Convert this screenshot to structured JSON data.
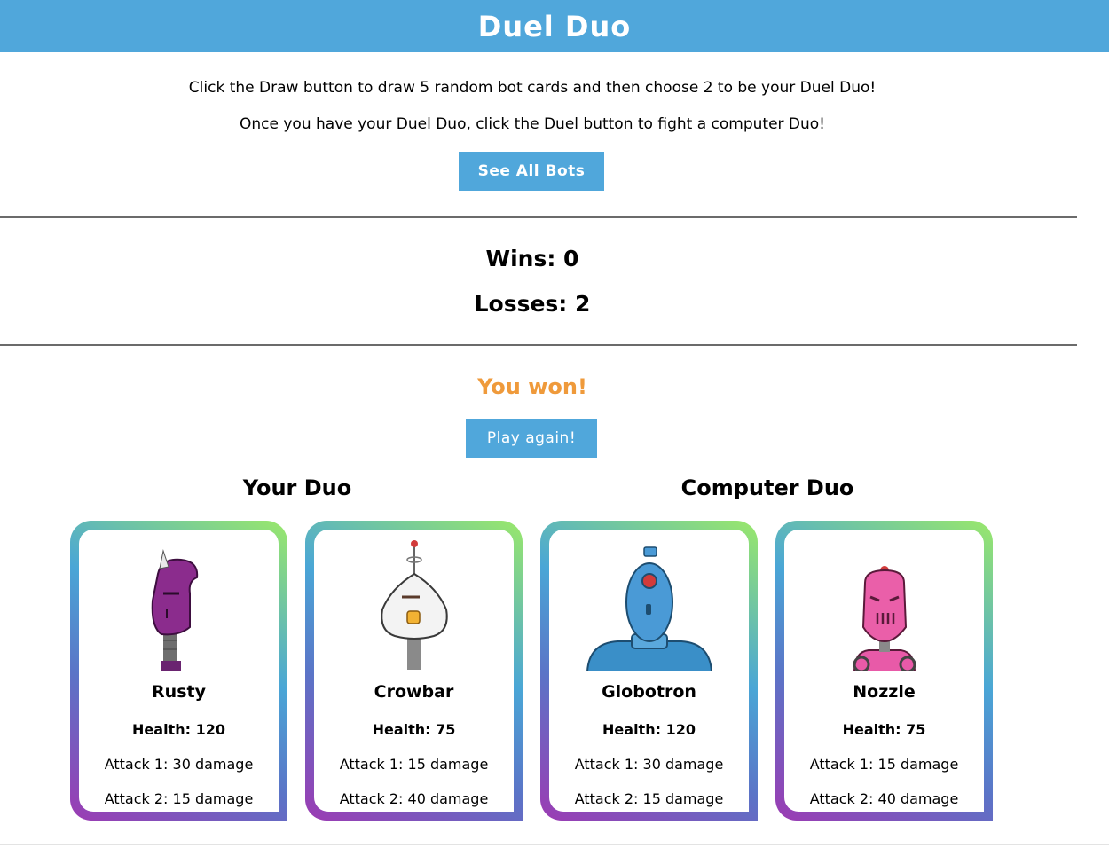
{
  "header": {
    "title": "Duel Duo"
  },
  "intro": {
    "line1": "Click the Draw button to draw 5 random bot cards and then choose 2 to be your Duel Duo!",
    "line2": "Once you have your Duel Duo, click the Duel button to fight a computer Duo!"
  },
  "buttons": {
    "see_all": "See All Bots",
    "play_again": "Play again!"
  },
  "score": {
    "wins": "Wins: 0",
    "losses": "Losses: 2"
  },
  "result": {
    "text": "You won!",
    "color": "#ef9a3b"
  },
  "duos": {
    "your_title": "Your Duo",
    "computer_title": "Computer Duo"
  },
  "cards": [
    {
      "name": "Rusty",
      "health": "Health: 120",
      "attack1": "Attack 1: 30 damage",
      "attack2": "Attack 2: 15 damage",
      "image": "purple-robot-icon"
    },
    {
      "name": "Crowbar",
      "health": "Health: 75",
      "attack1": "Attack 1: 15 damage",
      "attack2": "Attack 2: 40 damage",
      "image": "white-robot-icon"
    },
    {
      "name": "Globotron",
      "health": "Health: 120",
      "attack1": "Attack 1: 30 damage",
      "attack2": "Attack 2: 15 damage",
      "image": "blue-robot-icon"
    },
    {
      "name": "Nozzle",
      "health": "Health: 75",
      "attack1": "Attack 1: 15 damage",
      "attack2": "Attack 2: 40 damage",
      "image": "pink-robot-icon"
    }
  ],
  "colors": {
    "accent": "#50a7db",
    "result": "#ef9a3b"
  }
}
